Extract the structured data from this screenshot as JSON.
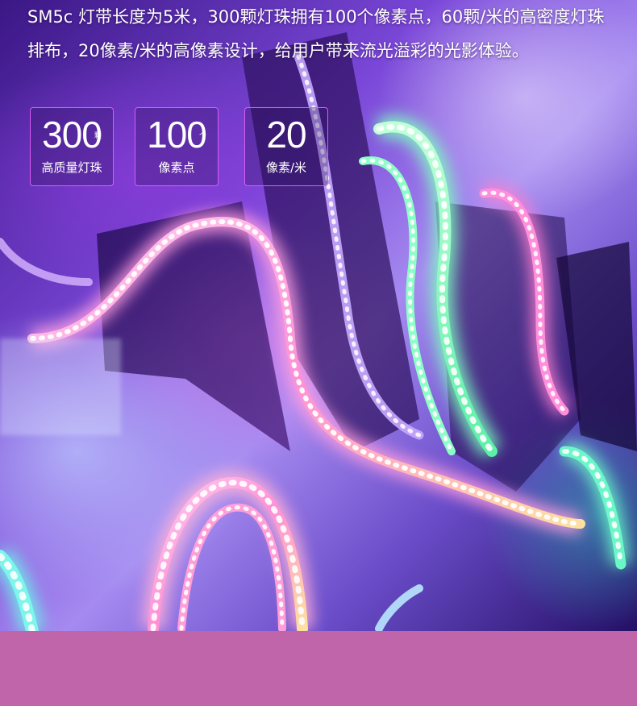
{
  "description": "SM5c 灯带长度为5米，300颗灯珠拥有100个像素点，60颗/米的高密度灯珠排布，20像素/米的高像素设计，给用户带来流光溢彩的光影体验。",
  "badges": [
    {
      "number": "300",
      "unit": "颗",
      "label": "高质量灯珠"
    },
    {
      "number": "100",
      "unit": "个",
      "label": "像素点"
    },
    {
      "number": "20",
      "unit": "",
      "label": "像素/米"
    }
  ],
  "colors": {
    "badge_border": "#d95cf4",
    "footer_band": "#c065a9",
    "text": "#ffffff"
  },
  "icons": [
    "led-light-strip-photo"
  ]
}
